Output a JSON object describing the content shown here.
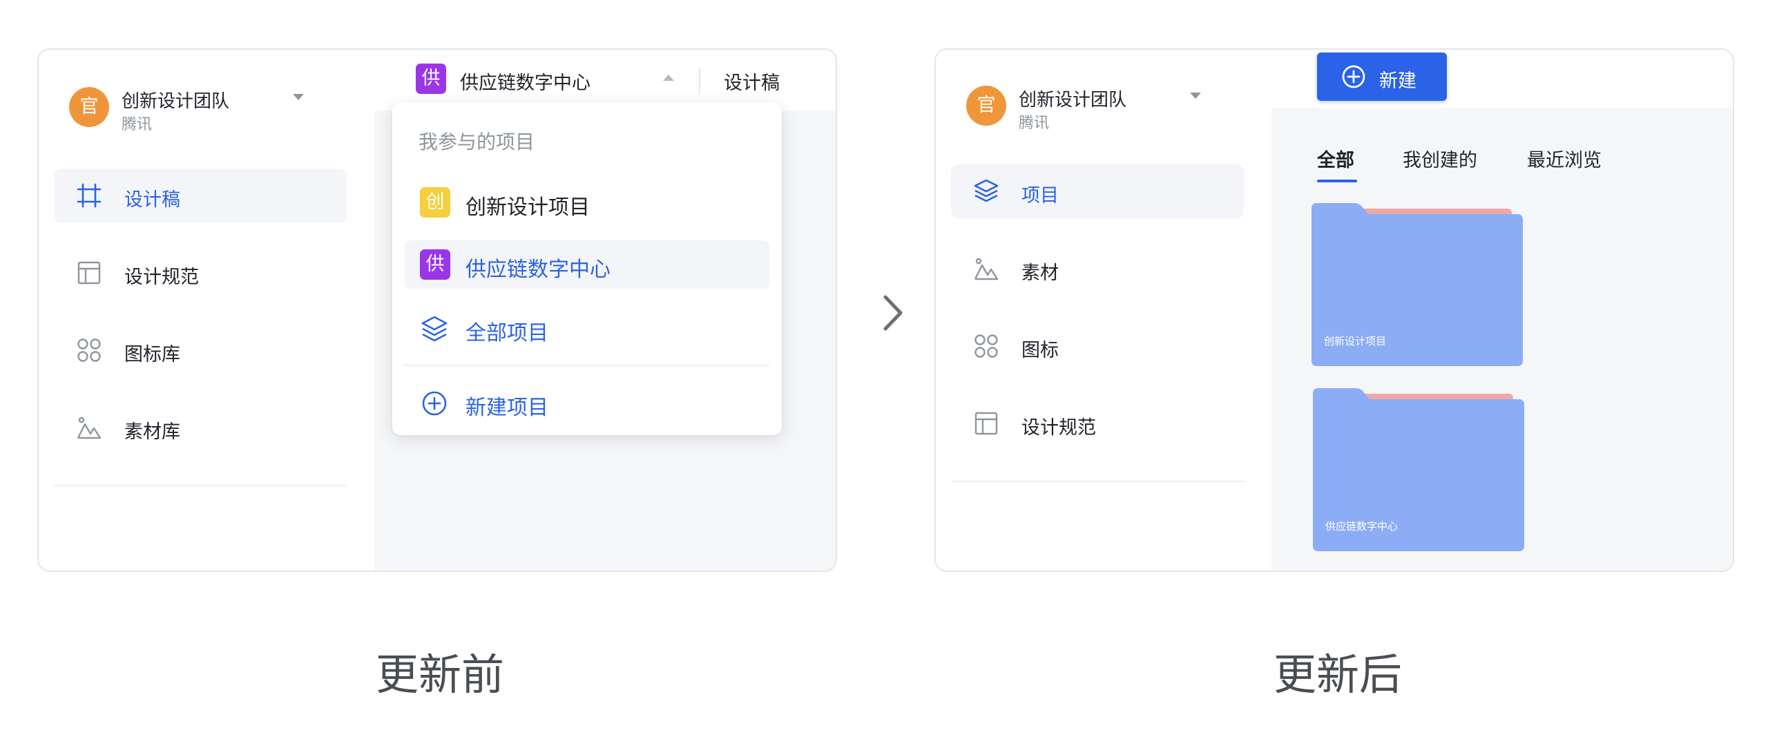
{
  "colors": {
    "accent": "#2a62e8",
    "avatar": "#f0963a",
    "badge_purple": "#9b35e8",
    "badge_yellow": "#f5cf3c",
    "folder_front": "#8cacf6",
    "folder_back": "#f0a8a4"
  },
  "before": {
    "team": {
      "avatar": "官",
      "name": "创新设计团队",
      "sub": "腾讯"
    },
    "nav": [
      {
        "label": "设计稿",
        "icon": "frame-icon",
        "active": true
      },
      {
        "label": "设计规范",
        "icon": "layout-icon",
        "active": false
      },
      {
        "label": "图标库",
        "icon": "icons-grid-icon",
        "active": false
      },
      {
        "label": "素材库",
        "icon": "mountain-image-icon",
        "active": false
      }
    ],
    "project_switch": {
      "badge": "供",
      "title": "供应链数字中心"
    },
    "top_tab": "设计稿",
    "dropdown": {
      "header": "我参与的项目",
      "items": [
        {
          "badge": "创",
          "label": "创新设计项目"
        },
        {
          "badge": "供",
          "label": "供应链数字中心",
          "selected": true
        },
        {
          "label": "全部项目",
          "icon": "layers-icon"
        }
      ],
      "new_label": "新建项目"
    },
    "caption": "更新前"
  },
  "after": {
    "team": {
      "avatar": "官",
      "name": "创新设计团队",
      "sub": "腾讯"
    },
    "nav": [
      {
        "label": "项目",
        "icon": "layers-icon",
        "active": true
      },
      {
        "label": "素材",
        "icon": "mountain-image-icon",
        "active": false
      },
      {
        "label": "图标",
        "icon": "icons-grid-icon",
        "active": false
      },
      {
        "label": "设计规范",
        "icon": "layout-icon",
        "active": false
      }
    ],
    "new_button": "新建",
    "tabs": [
      {
        "label": "全部",
        "active": true
      },
      {
        "label": "我创建的"
      },
      {
        "label": "最近浏览"
      }
    ],
    "folders": [
      {
        "label": "创新设计项目"
      },
      {
        "label": "供应链数字中心"
      }
    ],
    "caption": "更新后"
  }
}
